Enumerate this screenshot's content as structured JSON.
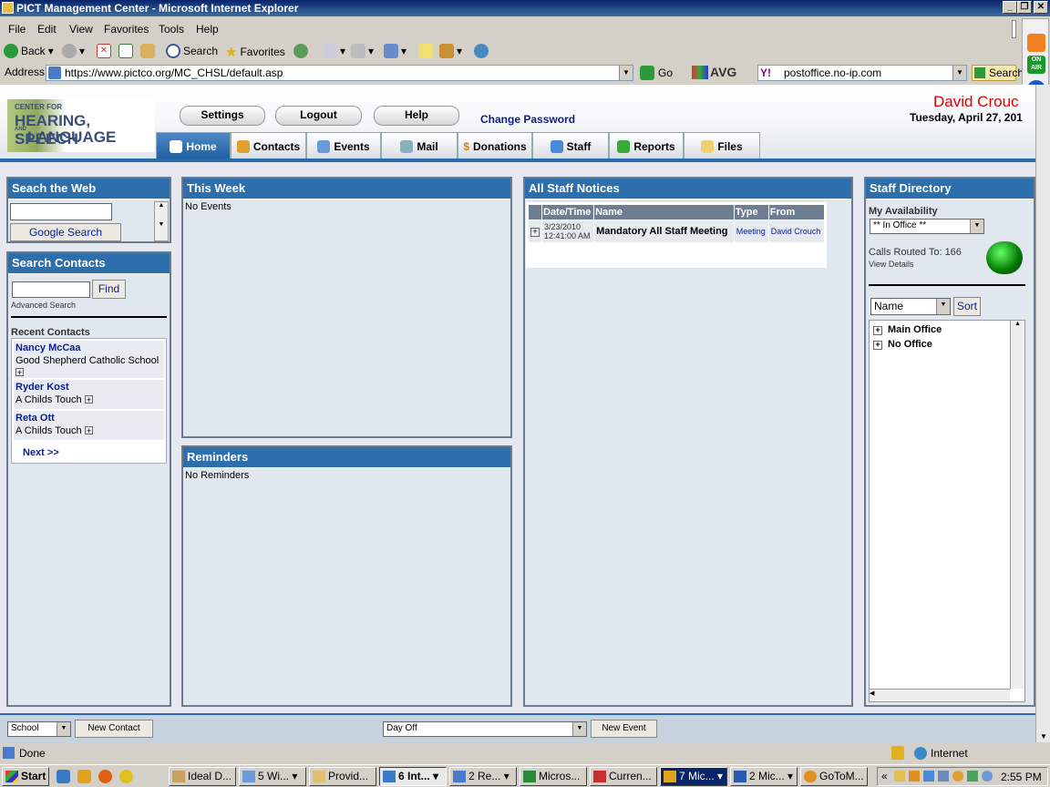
{
  "window": {
    "title": "PICT Management Center - Microsoft Internet Explorer"
  },
  "menu": [
    "File",
    "Edit",
    "View",
    "Favorites",
    "Tools",
    "Help"
  ],
  "toolbar": {
    "back": "Back",
    "search": "Search",
    "favorites": "Favorites"
  },
  "address": {
    "label": "Address",
    "url": "https://www.pictco.org/MC_CHSL/default.asp",
    "go": "Go",
    "avg": "AVG",
    "search_box": "postoffice.no-ip.com",
    "search_btn": "Search"
  },
  "header": {
    "logo_line1": "CENTER FOR",
    "logo_line2": "HEARING, SPEECH",
    "logo_line3": "LANGUAGE",
    "logo_and": "AND",
    "settings": "Settings",
    "logout": "Logout",
    "help": "Help",
    "change_password": "Change Password",
    "user": "David Crouc",
    "date": "Tuesday, April 27, 201"
  },
  "tabs": [
    "Home",
    "Contacts",
    "Events",
    "Mail",
    "Donations",
    "Staff",
    "Reports",
    "Files"
  ],
  "search_web": {
    "title": "Seach the Web",
    "button": "Google Search"
  },
  "search_contacts": {
    "title": "Search Contacts",
    "find": "Find",
    "advanced": "Advanced Search",
    "recent_title": "Recent Contacts",
    "next": "Next >>",
    "contacts": [
      {
        "name": "Nancy McCaa",
        "org": "Good Shepherd Catholic School"
      },
      {
        "name": "Ryder Kost",
        "org": "A Childs Touch"
      },
      {
        "name": "Reta Ott",
        "org": "A Childs Touch"
      }
    ]
  },
  "this_week": {
    "title": "This Week",
    "empty": "No Events"
  },
  "reminders": {
    "title": "Reminders",
    "empty": "No Reminders"
  },
  "notices": {
    "title": "All Staff Notices",
    "headers": [
      "Date/Time",
      "Name",
      "Type",
      "From"
    ],
    "rows": [
      {
        "date": "3/23/2010",
        "time": "12:41:00 AM",
        "name": "Mandatory All Staff Meeting",
        "type": "Meeting",
        "from": "David Crouch"
      }
    ]
  },
  "staff": {
    "title": "Staff Directory",
    "availability_label": "My Availability",
    "availability": "** In Office **",
    "calls_routed": "Calls Routed To: 166",
    "view_details": "View Details",
    "sort_field": "Name",
    "sort": "Sort",
    "groups": [
      "Main Office",
      "No Office"
    ]
  },
  "footer": {
    "school": "School",
    "new_contact": "New Contact",
    "day_off": "Day Off",
    "new_event": "New Event"
  },
  "status": {
    "text": "Done",
    "zone": "Internet"
  },
  "taskbar": {
    "start": "Start",
    "clock": "2:55 PM",
    "tasks": [
      "Ideal D...",
      "5 Wi...",
      "Provid...",
      "6 Int...",
      "2 Re...",
      "Micros...",
      "Curren...",
      "7 Mic...",
      "2 Mic...",
      "GoToM..."
    ]
  }
}
